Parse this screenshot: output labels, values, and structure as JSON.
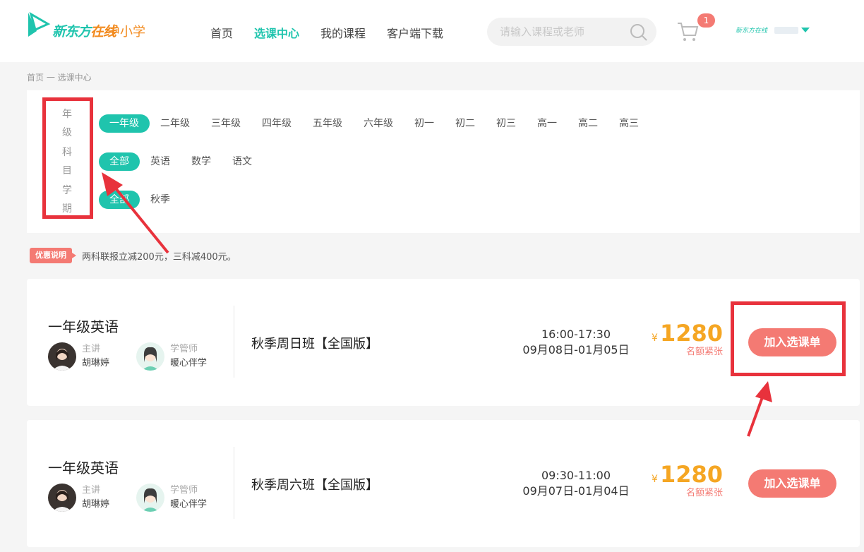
{
  "header": {
    "logo_main_a": "新东方",
    "logo_main_b": "在线",
    "logo_sub": "中小学",
    "nav": [
      "首页",
      "选课中心",
      "我的课程",
      "客户端下载"
    ],
    "nav_active": "选课中心",
    "search_placeholder": "请输入课程或老师",
    "cart_count": "1",
    "user_logo": "新东方在线"
  },
  "breadcrumb": "首页 一 选课中心",
  "filters": {
    "grade": {
      "label": "年级",
      "options": [
        "一年级",
        "二年级",
        "三年级",
        "四年级",
        "五年级",
        "六年级",
        "初一",
        "初二",
        "初三",
        "高一",
        "高二",
        "高三"
      ],
      "selected": "一年级"
    },
    "subject": {
      "label": "科目",
      "options": [
        "全部",
        "英语",
        "数学",
        "语文"
      ],
      "selected": "全部"
    },
    "term": {
      "label": "学期",
      "options": [
        "全部",
        "秋季"
      ],
      "selected": "全部"
    }
  },
  "promo": {
    "tag": "优惠说明",
    "text": "两科联报立减200元，三科减400元。"
  },
  "courses": [
    {
      "title": "一年级英语",
      "lecturer_role": "主讲",
      "lecturer_name": "胡琳婷",
      "tutor_role": "学管师",
      "tutor_name": "暖心伴学",
      "class_name": "秋季周日班【全国版】",
      "time": "16:00-17:30",
      "dates": "09月08日-01月05日",
      "currency": "¥",
      "price": "1280",
      "stock": "名额紧张",
      "button": "加入选课单"
    },
    {
      "title": "一年级英语",
      "lecturer_role": "主讲",
      "lecturer_name": "胡琳婷",
      "tutor_role": "学管师",
      "tutor_name": "暖心伴学",
      "class_name": "秋季周六班【全国版】",
      "time": "09:30-11:00",
      "dates": "09月07日-01月04日",
      "currency": "¥",
      "price": "1280",
      "stock": "名额紧张",
      "button": "加入选课单"
    }
  ],
  "colors": {
    "brand": "#1fc4ad",
    "accent_orange": "#f5a623",
    "button": "#f47a73",
    "annotation_red": "#e8323c"
  }
}
